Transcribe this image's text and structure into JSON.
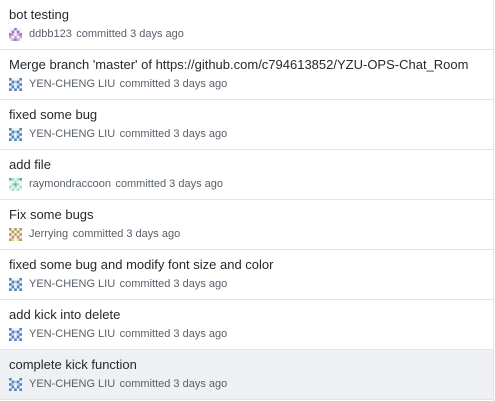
{
  "commits": [
    {
      "title": "bot testing",
      "author": "ddbb123",
      "time": "committed 3 days ago",
      "avatar": "avatar-ddbb123",
      "colors": [
        "#c9a6d9",
        "#9b6fbf"
      ]
    },
    {
      "title": "Merge branch 'master' of https://github.com/c794613852/YZU-OPS-Chat_Room",
      "author": "YEN-CHENG LIU",
      "time": "committed 3 days ago",
      "avatar": "avatar-yen-cheng-liu",
      "colors": [
        "#a9c7e8",
        "#4f83c2"
      ]
    },
    {
      "title": "fixed some bug",
      "author": "YEN-CHENG LIU",
      "time": "committed 3 days ago",
      "avatar": "avatar-yen-cheng-liu",
      "colors": [
        "#a9c7e8",
        "#4f83c2"
      ]
    },
    {
      "title": "add file",
      "author": "raymondraccoon",
      "time": "committed 3 days ago",
      "avatar": "avatar-raymondraccoon",
      "colors": [
        "#a8e0d0",
        "#4fb99a"
      ]
    },
    {
      "title": "Fix some bugs",
      "author": "Jerrying",
      "time": "committed 3 days ago",
      "avatar": "avatar-jerrying",
      "colors": [
        "#e8d6a0",
        "#b89a4a"
      ]
    },
    {
      "title": "fixed some bug and modify font size and color",
      "author": "YEN-CHENG LIU",
      "time": "committed 3 days ago",
      "avatar": "avatar-yen-cheng-liu",
      "colors": [
        "#a9c7e8",
        "#4f83c2"
      ]
    },
    {
      "title": "add kick into delete",
      "author": "YEN-CHENG LIU",
      "time": "committed 3 days ago",
      "avatar": "avatar-yen-cheng-liu",
      "colors": [
        "#a9c7e8",
        "#4f83c2"
      ]
    },
    {
      "title": "complete kick function",
      "author": "YEN-CHENG LIU",
      "time": "committed 3 days ago",
      "avatar": "avatar-yen-cheng-liu",
      "colors": [
        "#a9c7e8",
        "#4f83c2"
      ],
      "selected": true
    }
  ]
}
